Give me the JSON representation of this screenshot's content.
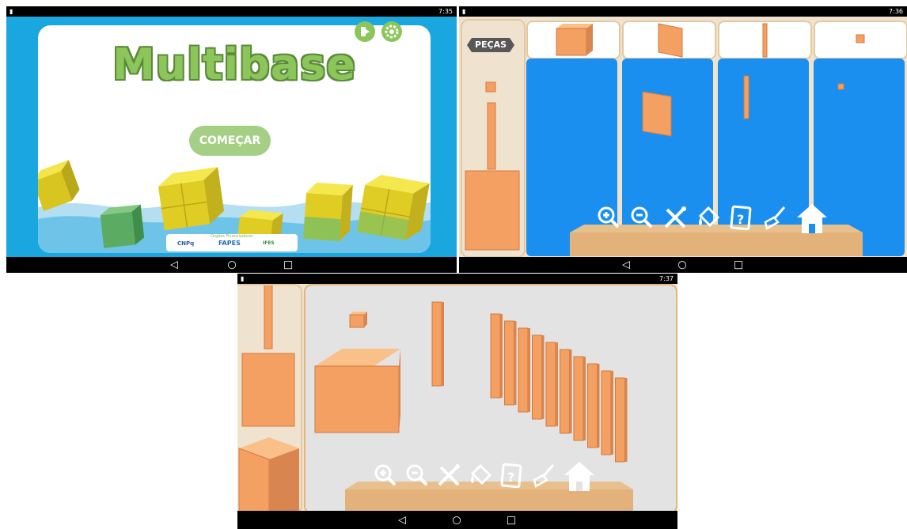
{
  "screen1": {
    "status_time": "7:35",
    "title": "Multibase",
    "start_button": "COMEÇAR",
    "sponsor_heading": "Órgãos Financiadores",
    "sponsor_logos": [
      "CNPq",
      "FAPES",
      "IFES"
    ],
    "top_icons": [
      "exit-icon",
      "gear-icon"
    ],
    "colors": {
      "background": "#1aa7e0",
      "title": "#8cc65a",
      "button": "#a5cf84",
      "cube": "#e8d52b"
    }
  },
  "screen2": {
    "status_time": "7:36",
    "pieces_label": "PEÇAS",
    "columns": [
      "cube",
      "plate",
      "bar",
      "unit"
    ],
    "toolbar": [
      "zoom-in-icon",
      "zoom-out-icon",
      "tools-icon",
      "paint-bucket-icon",
      "help-icon",
      "broom-icon",
      "home-icon"
    ],
    "colors": {
      "workspace": "#1a8ff0",
      "piece": "#f4a063",
      "wood": "#e2b27a"
    }
  },
  "screen3": {
    "status_time": "7:37",
    "toolbar": [
      "zoom-in-icon",
      "zoom-out-icon",
      "tools-icon",
      "paint-bucket-icon",
      "help-icon",
      "broom-icon",
      "home-icon"
    ],
    "bar_count": 10,
    "colors": {
      "workspace": "#e3e3e3",
      "piece": "#f4a063"
    }
  },
  "nav": {
    "back": "◁",
    "home": "○",
    "recents": "□"
  }
}
